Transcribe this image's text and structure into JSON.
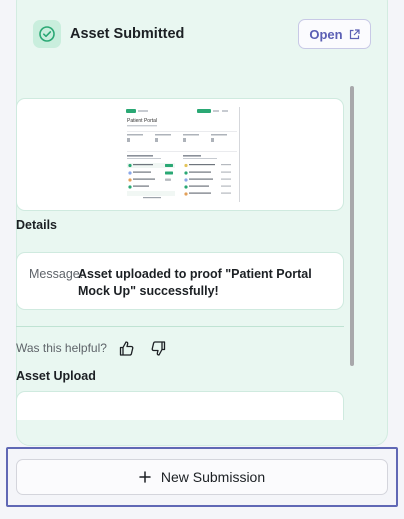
{
  "header": {
    "title": "Asset Submitted",
    "open_label": "Open",
    "status_icon": "check-circle-icon",
    "open_icon": "external-link-icon",
    "accent_color": "#5b5fb4",
    "success_color": "#2aa874"
  },
  "preview": {
    "thumbnail_title": "Patient Portal"
  },
  "details": {
    "heading": "Details",
    "message_key": "Message:",
    "message_value": "Asset uploaded to proof \"Patient Portal Mock Up\" successfully!"
  },
  "feedback": {
    "prompt": "Was this helpful?",
    "thumbs_up_icon": "thumbs-up-icon",
    "thumbs_down_icon": "thumbs-down-icon"
  },
  "upload": {
    "heading": "Asset Upload"
  },
  "footer": {
    "new_submission_label": "New Submission",
    "plus_icon": "plus-icon"
  }
}
